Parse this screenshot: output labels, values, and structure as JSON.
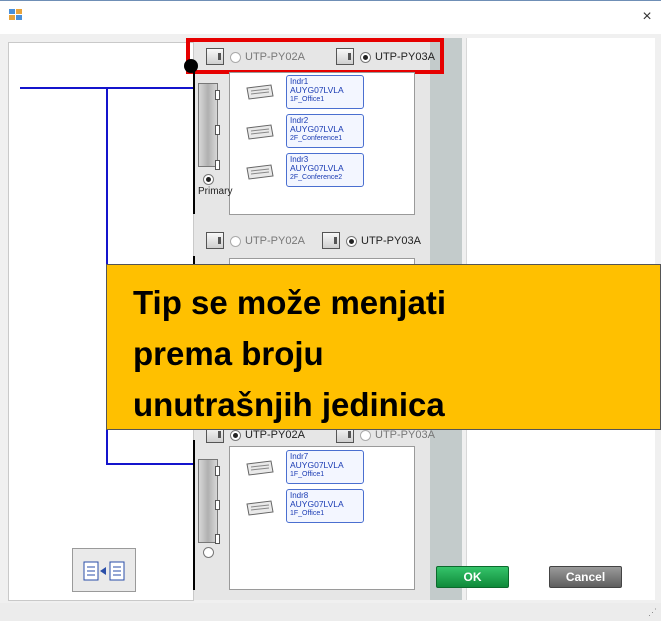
{
  "window": {
    "title": "",
    "close_glyph": "×"
  },
  "units": {
    "top": {
      "option_a": "UTP-PY02A",
      "option_b": "UTP-PY03A",
      "selected": "option_b",
      "radio_label": "Primary",
      "indoors": [
        {
          "name": "Indr1",
          "model": "AUYG07LVLA",
          "location": "1F_Office1"
        },
        {
          "name": "Indr2",
          "model": "AUYG07LVLA",
          "location": "2F_Conference1"
        },
        {
          "name": "Indr3",
          "model": "AUYG07LVLA",
          "location": "2F_Conference2"
        }
      ]
    },
    "middle": {
      "option_a": "UTP-PY02A",
      "option_b": "UTP-PY03A",
      "selected": "option_b"
    },
    "bottom": {
      "option_a": "UTP-PY02A",
      "option_b": "UTP-PY03A",
      "selected": "option_a",
      "indoors": [
        {
          "name": "Indr7",
          "model": "AUYG07LVLA",
          "location": "1F_Office1"
        },
        {
          "name": "Indr8",
          "model": "AUYG07LVLA",
          "location": "1F_Office1"
        }
      ]
    }
  },
  "callout": {
    "lines": [
      "Tip se može menjati",
      "prema broju",
      "unutrašnjih jedinica"
    ]
  },
  "buttons": {
    "ok": "OK",
    "cancel": "Cancel"
  },
  "icons": {
    "app": "app-window-icon",
    "swap": "swap-units-icon",
    "cassette": "cassette-unit-icon",
    "outdoor": "outdoor-unit-icon"
  },
  "colors": {
    "highlight": "#e60000",
    "callout": "#ffc000",
    "ok": "#1aa64c",
    "line": "#1414cc"
  }
}
